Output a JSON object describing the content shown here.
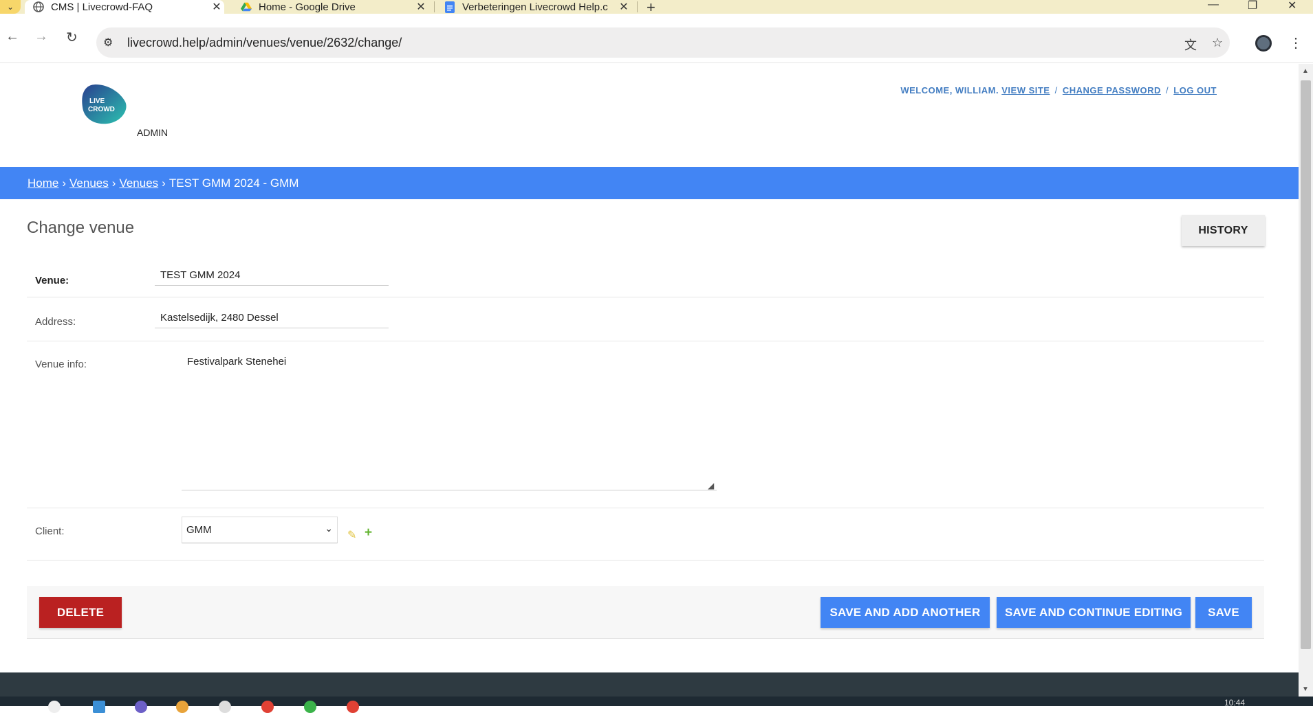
{
  "browser": {
    "tabs": [
      {
        "title": "CMS | Livecrowd-FAQ",
        "active": true,
        "icon": "globe-icon"
      },
      {
        "title": "Home - Google Drive",
        "active": false,
        "icon": "google-drive-icon"
      },
      {
        "title": "Verbeteringen Livecrowd Help.c",
        "active": false,
        "icon": "google-docs-icon"
      }
    ],
    "url": "livecrowd.help/admin/venues/venue/2632/change/"
  },
  "header": {
    "logo_text_1": "LIVE",
    "logo_text_2": "CROWD",
    "admin_label": "ADMIN",
    "welcome": "WELCOME, WILLIAM.",
    "view_site": "VIEW SITE",
    "change_password": "CHANGE PASSWORD",
    "log_out": "LOG OUT",
    "separator": "/"
  },
  "breadcrumbs": {
    "home": "Home",
    "venues_app": "Venues",
    "venues_model": "Venues",
    "current": "TEST GMM 2024 - GMM",
    "arrow": "›"
  },
  "content": {
    "title": "Change venue",
    "history_label": "HISTORY"
  },
  "form": {
    "venue_label": "Venue:",
    "venue_value": "TEST GMM 2024",
    "address_label": "Address:",
    "address_value": "Kastelsedijk, 2480 Dessel",
    "venue_info_label": "Venue info:",
    "venue_info_value": "Festivalpark Stenehei",
    "client_label": "Client:",
    "client_value": "GMM"
  },
  "actions": {
    "delete": "DELETE",
    "save_add_another": "SAVE AND ADD ANOTHER",
    "save_continue": "SAVE AND CONTINUE EDITING",
    "save": "SAVE"
  },
  "system": {
    "clock": "10:44"
  },
  "colors": {
    "primary": "#4285f4",
    "delete": "#ba2121",
    "link": "#447ec2",
    "footer": "#2e3a41"
  }
}
